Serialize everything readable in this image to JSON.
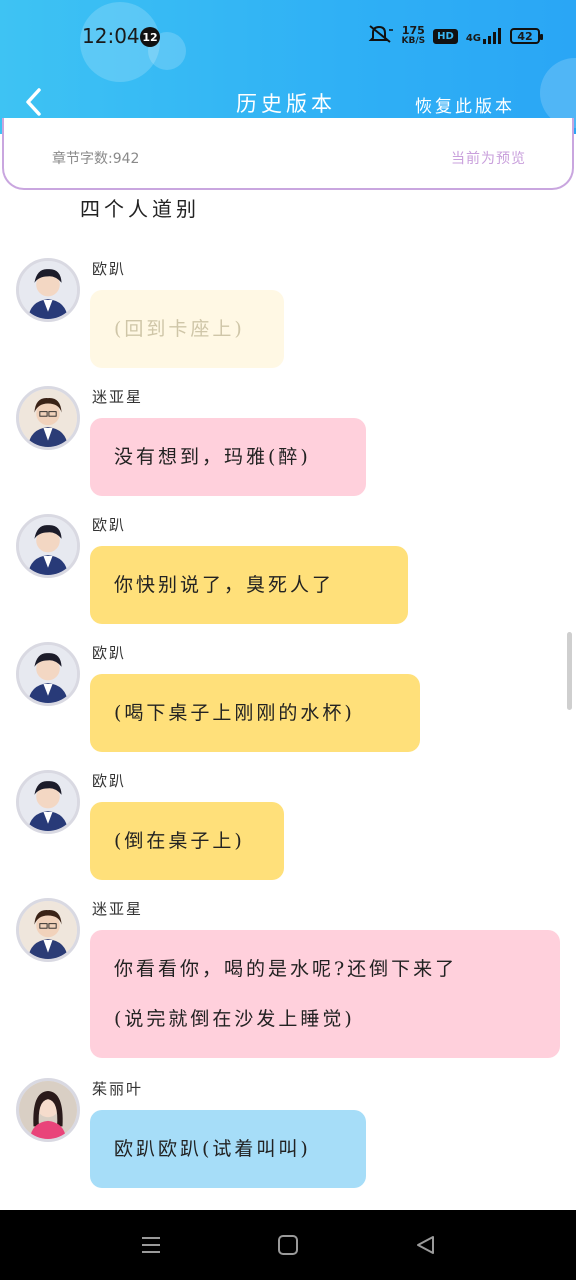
{
  "status_bar": {
    "time": "12:04",
    "notification_count": "12",
    "net_speed_value": "175",
    "net_speed_unit": "KB/S",
    "hd_label": "HD",
    "signal_label": "4G",
    "battery": "42"
  },
  "header": {
    "title": "历史版本",
    "restore_button": "恢复此版本"
  },
  "info": {
    "word_count": "章节字数:942",
    "preview_label": "当前为预览"
  },
  "section_title": "四个人道别",
  "messages": [
    {
      "speaker": "欧趴",
      "text": "(回到卡座上)",
      "color": "#fff8e4"
    },
    {
      "speaker": "迷亚星",
      "text": "没有想到，玛雅(醉)",
      "color": "#ffd0dc"
    },
    {
      "speaker": "欧趴",
      "text": "你快别说了，臭死人了",
      "color": "#ffe07a"
    },
    {
      "speaker": "欧趴",
      "text": "(喝下桌子上刚刚的水杯)",
      "color": "#ffe07a"
    },
    {
      "speaker": "欧趴",
      "text": "(倒在桌子上)",
      "color": "#ffe07a"
    },
    {
      "speaker": "迷亚星",
      "text_line1": "你看看你，喝的是水呢?还倒下来了",
      "text_line2": "(说完就倒在沙发上睡觉)",
      "color": "#ffd0dc"
    },
    {
      "speaker": "茱丽叶",
      "text": "欧趴欧趴(试着叫叫)",
      "color": "#a6ddf8"
    }
  ],
  "icons": {
    "back": "chevron-left-icon",
    "mute": "mute-icon",
    "menu": "menu-icon",
    "home": "home-icon",
    "nav_back": "triangle-back-icon"
  }
}
